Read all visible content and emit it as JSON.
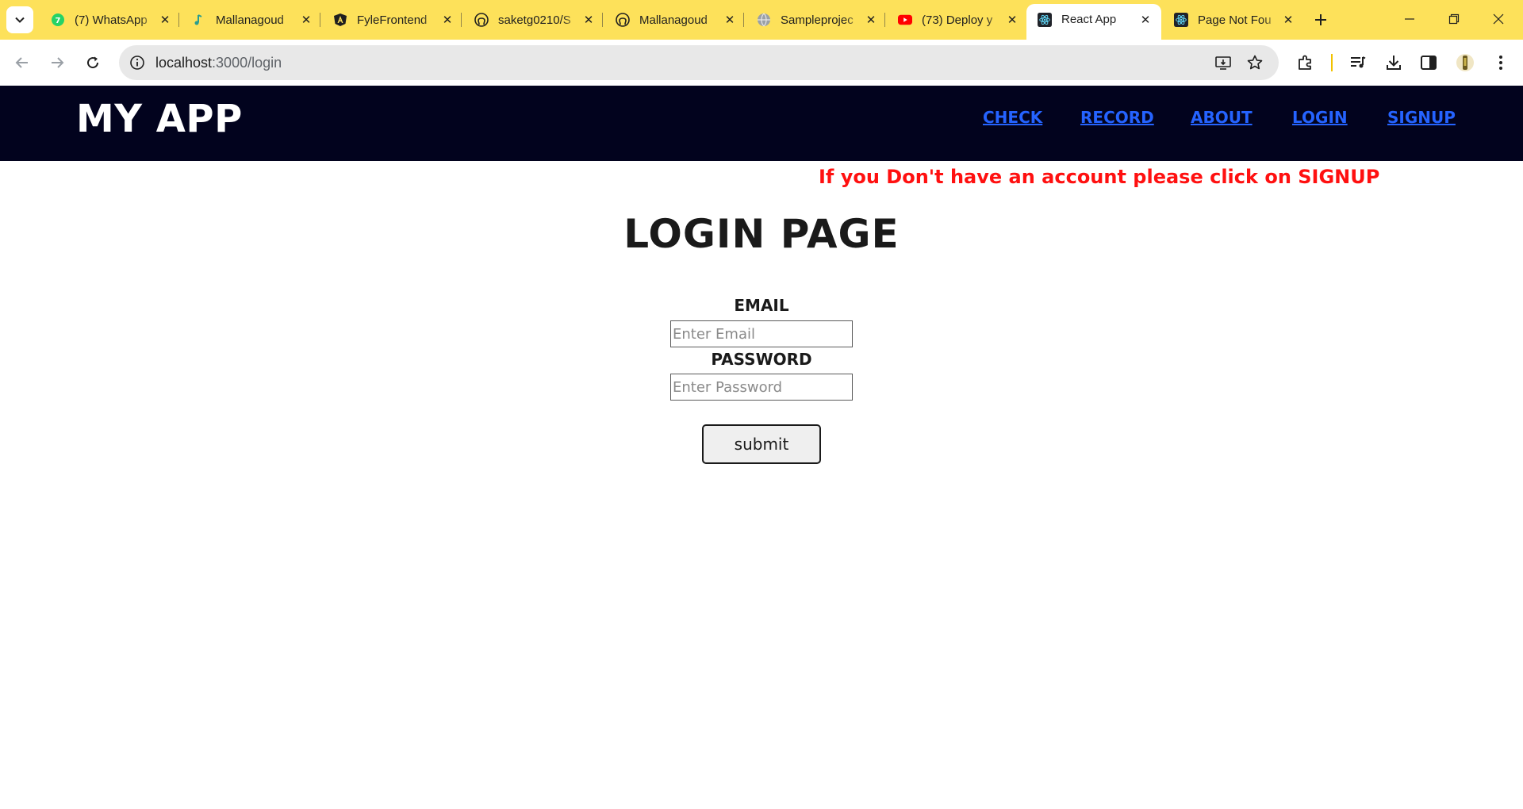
{
  "browser": {
    "tabs": [
      {
        "title": "(7) WhatsApp",
        "icon": "whatsapp-icon",
        "active": false
      },
      {
        "title": "Mallanagoud",
        "icon": "music-note-icon",
        "active": false
      },
      {
        "title": "FyleFrontend",
        "icon": "angular-icon",
        "active": false
      },
      {
        "title": "saketg0210/S",
        "icon": "github-icon",
        "active": false
      },
      {
        "title": "Mallanagoud",
        "icon": "github-icon",
        "active": false
      },
      {
        "title": "Sampleprojec",
        "icon": "globe-icon",
        "active": false
      },
      {
        "title": "(73) Deploy y",
        "icon": "youtube-icon",
        "active": false
      },
      {
        "title": "React App",
        "icon": "react-icon",
        "active": true
      },
      {
        "title": "Page Not Fou",
        "icon": "react-icon",
        "active": false
      }
    ],
    "url": {
      "host": "localhost",
      "rest": ":3000/login"
    },
    "colors": {
      "tabstrip": "#fde15a",
      "omnibox": "#e8e8e8"
    }
  },
  "app": {
    "brand": "MY APP",
    "nav": [
      "CHECK",
      "RECORD",
      "ABOUT",
      "LOGIN",
      "SIGNUP"
    ],
    "colors": {
      "navbar": "#02031e",
      "link": "#2563ff",
      "notice": "#ff1010"
    }
  },
  "login": {
    "notice": "If you Don't have an account please click on SIGNUP",
    "title": "LOGIN PAGE",
    "email_label": "EMAIL",
    "email_placeholder": "Enter Email",
    "password_label": "PASSWORD",
    "password_placeholder": "Enter Password",
    "submit_label": "submit"
  }
}
